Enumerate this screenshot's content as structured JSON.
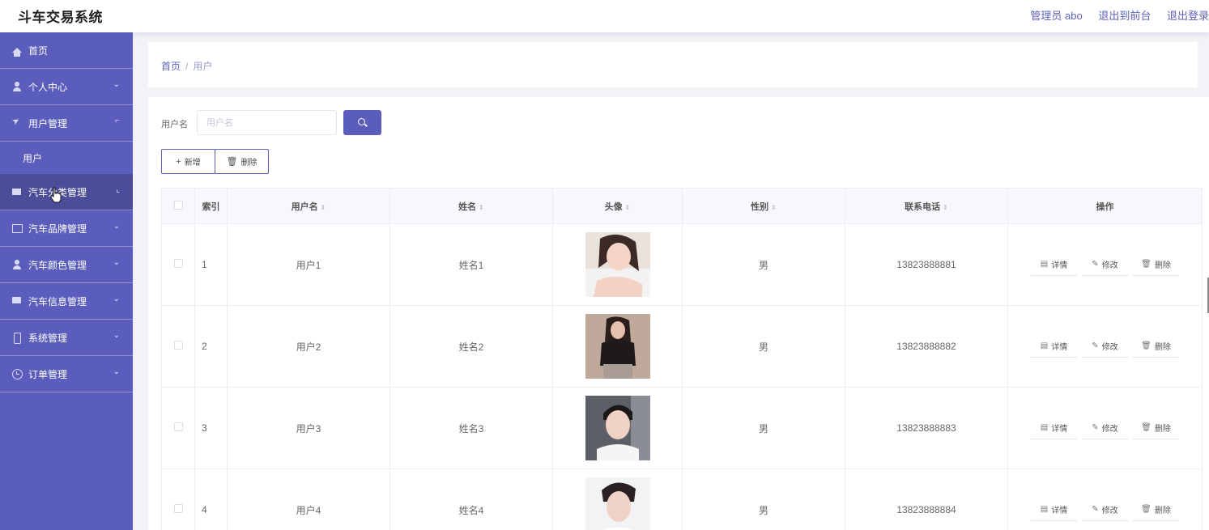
{
  "app": {
    "title": "斗车交易系统"
  },
  "top_links": {
    "admin": "管理员 abo",
    "front": "退出到前台",
    "logout": "退出登录"
  },
  "sidebar": {
    "items": [
      {
        "label": "首页"
      },
      {
        "label": "个人中心",
        "arrow": "⌄"
      },
      {
        "label": "用户管理",
        "arrow": "⌐"
      },
      {
        "label": "用户"
      },
      {
        "label": "汽车分类管理",
        "arrow": "⌞"
      },
      {
        "label": "汽车品牌管理",
        "arrow": "⌄"
      },
      {
        "label": "汽车颜色管理",
        "arrow": "⌄"
      },
      {
        "label": "汽车信息管理",
        "arrow": "⌄"
      },
      {
        "label": "系统管理",
        "arrow": "⌄"
      },
      {
        "label": "订单管理",
        "arrow": "⌄"
      }
    ]
  },
  "breadcrumb": {
    "home": "首页",
    "sep": "/",
    "current": "用户"
  },
  "search": {
    "label": "用户名",
    "placeholder": "用户名"
  },
  "toolbar": {
    "add_icon": "+",
    "add": "新增",
    "delete_icon": "🗑",
    "delete": "删除"
  },
  "table": {
    "headers": [
      "索引",
      "用户名",
      "姓名",
      "头像",
      "性别",
      "联系电话",
      "操作"
    ],
    "sort_icon": "⇕",
    "rows": [
      {
        "index": "1",
        "username": "用户1",
        "name": "姓名1",
        "gender": "男",
        "phone": "13823888881"
      },
      {
        "index": "2",
        "username": "用户2",
        "name": "姓名2",
        "gender": "男",
        "phone": "13823888882"
      },
      {
        "index": "3",
        "username": "用户3",
        "name": "姓名3",
        "gender": "男",
        "phone": "13823888883"
      },
      {
        "index": "4",
        "username": "用户4",
        "name": "姓名4",
        "gender": "男",
        "phone": "13823888884"
      }
    ],
    "actions": {
      "detail_icon": "▤",
      "detail": "详情",
      "edit_icon": "✎",
      "edit": "修改",
      "delete_icon": "🗑",
      "delete": "删除"
    }
  },
  "colors": {
    "accent": "#5a5dbb",
    "sidebar_active": "#4b4d99",
    "link": "#5d62b8"
  }
}
